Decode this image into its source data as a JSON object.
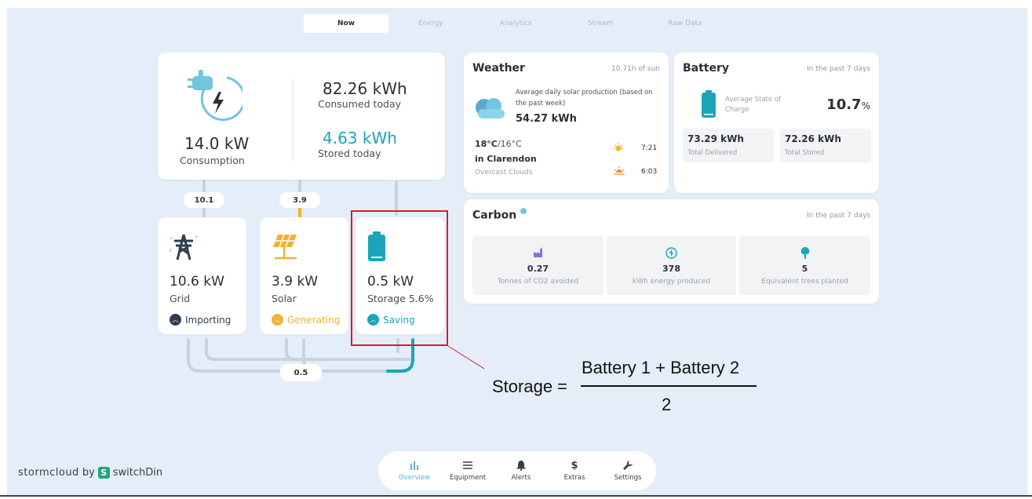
{
  "tabs": [
    "Now",
    "Energy",
    "Analytics",
    "Stream",
    "Raw Data"
  ],
  "consumption": {
    "power": "14.0 kW",
    "power_label": "Consumption",
    "consumed": "82.26 kWh",
    "consumed_label": "Consumed today",
    "stored": "4.63 kWh",
    "stored_label": "Stored today",
    "icon": "plug-icon"
  },
  "flows": {
    "grid_to_home": "10.1",
    "solar_to_home": "3.9",
    "bottom": "0.5"
  },
  "nodes": {
    "grid": {
      "value": "10.6 kW",
      "label": "Grid",
      "status": "Importing",
      "color": "#2f3f52",
      "icon": "transmission-tower-icon"
    },
    "solar": {
      "value": "3.9 kW",
      "label": "Solar",
      "status": "Generating",
      "color": "#f2b233",
      "icon": "solar-panel-icon"
    },
    "storage": {
      "value": "0.5 kW",
      "label": "Storage 5.6%",
      "status": "Saving",
      "color": "#1aa5b8",
      "icon": "battery-icon"
    }
  },
  "weather": {
    "title": "Weather",
    "sun_hours": "10.71h of sun",
    "avg_label": "Average daily solar production (based on the past week)",
    "avg_value": "54.27 kWh",
    "temp_high": "18°C",
    "temp_low": "/16°C",
    "location": "in Clarendon",
    "conditions": "Overcast Clouds",
    "sunrise": "7:21",
    "sunset": "6:03",
    "icon": "cloud-icon"
  },
  "battery": {
    "title": "Battery",
    "period": "In the past 7 days",
    "soc_label": "Average State of Charge",
    "soc_value": "10.7",
    "soc_unit": "%",
    "delivered": "73.29 kWh",
    "delivered_label": "Total Delivered",
    "stored": "72.26 kWh",
    "stored_label": "Total Stored"
  },
  "carbon": {
    "title": "Carbon",
    "period": "In the past 7 days",
    "items": [
      {
        "value": "0.27",
        "label": "Tonnes of CO2 avoided",
        "icon": "factory-icon"
      },
      {
        "value": "378",
        "label": "kWh energy produced",
        "icon": "bolt-icon"
      },
      {
        "value": "5",
        "label": "Equivalent trees planted",
        "icon": "tree-icon"
      }
    ]
  },
  "annotation": {
    "lhs": "Storage =",
    "numerator": "Battery 1 + Battery 2",
    "denominator": "2"
  },
  "nav": [
    {
      "label": "Overview",
      "icon": "bar-chart-icon"
    },
    {
      "label": "Equipment",
      "icon": "list-icon"
    },
    {
      "label": "Alerts",
      "icon": "bell-icon"
    },
    {
      "label": "Extras",
      "icon": "dollar-icon"
    },
    {
      "label": "Settings",
      "icon": "wrench-icon"
    }
  ],
  "brand": {
    "name": "stormcloud",
    "by": "by",
    "partner": "switchDin"
  },
  "colors": {
    "accent": "#1aa5b8",
    "solar": "#f2b233",
    "grid": "#2f3f52",
    "highlight": "#d42020"
  }
}
